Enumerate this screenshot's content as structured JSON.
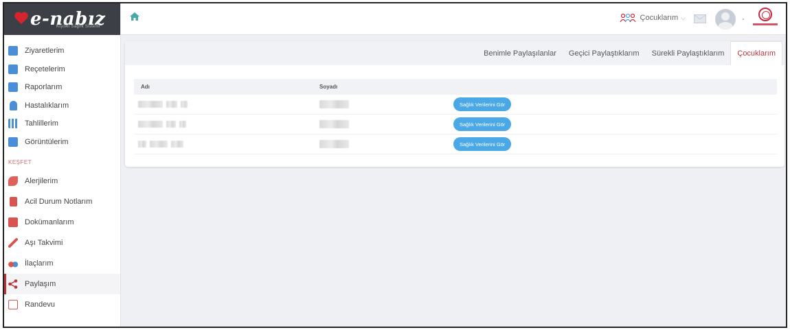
{
  "app": {
    "logo_text": "e-nabız",
    "logo_subtitle": "Kişisel Sağlık Sistemi"
  },
  "sidebar": {
    "items": [
      {
        "label": "Ziyaretlerim",
        "icon": "building-icon",
        "color": "#4a8fd6"
      },
      {
        "label": "Reçetelerim",
        "icon": "prescription-icon",
        "color": "#4a8fd6"
      },
      {
        "label": "Raporlarım",
        "icon": "report-icon",
        "color": "#4a8fd6"
      },
      {
        "label": "Hastalıklarım",
        "icon": "patient-icon",
        "color": "#4a8fd6"
      },
      {
        "label": "Tahlillerim",
        "icon": "test-tubes-icon",
        "color": "#4a8fd6"
      },
      {
        "label": "Görüntülerim",
        "icon": "image-scan-icon",
        "color": "#4a8fd6"
      }
    ],
    "section_label": "KEŞFET",
    "explore_items": [
      {
        "label": "Alerjilerim",
        "icon": "allergy-icon",
        "color": "#d9534f"
      },
      {
        "label": "Acil Durum Notlarım",
        "icon": "emergency-note-icon",
        "color": "#d9534f"
      },
      {
        "label": "Dokümanlarım",
        "icon": "documents-icon",
        "color": "#d9534f"
      },
      {
        "label": "Aşı Takvimi",
        "icon": "syringe-icon",
        "color": "#d9534f"
      },
      {
        "label": "İlaçlarım",
        "icon": "pills-icon",
        "color": "#d9534f"
      },
      {
        "label": "Paylaşım",
        "icon": "share-icon",
        "color": "#b9343a",
        "active": true
      },
      {
        "label": "Randevu",
        "icon": "calendar-icon",
        "color": "#d9534f"
      }
    ]
  },
  "topbar": {
    "children_label": "Çocuklarım"
  },
  "tabs": [
    {
      "label": "Benimle Paylaşılanlar"
    },
    {
      "label": "Geçici Paylaştıklarım"
    },
    {
      "label": "Sürekli Paylaştıklarım"
    },
    {
      "label": "Çocuklarım",
      "active": true
    }
  ],
  "table": {
    "headers": [
      "Adı",
      "Soyadı"
    ],
    "button_label": "Sağlık Verilerini Gör"
  },
  "colors": {
    "accent": "#b9343a",
    "button": "#4aa8e6",
    "sidebar_header": "#3c4046"
  }
}
